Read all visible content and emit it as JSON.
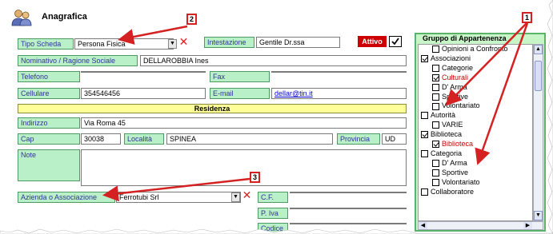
{
  "header": {
    "title": "Anagrafica",
    "icon": "users-icon"
  },
  "form": {
    "tipo_scheda": {
      "label": "Tipo Scheda",
      "value": "Persona Fisica"
    },
    "intestazione": {
      "label": "Intestazione",
      "value": "Gentile Dr.ssa"
    },
    "attivo": {
      "label": "Attivo",
      "checked": true
    },
    "nominativo": {
      "label": "Nominativo / Ragione Sociale",
      "value": "DELLAROBBIA  Ines"
    },
    "telefono": {
      "label": "Telefono",
      "value": ""
    },
    "fax": {
      "label": "Fax",
      "value": ""
    },
    "cellulare": {
      "label": "Cellulare",
      "value": "354546456"
    },
    "email": {
      "label": "E-mail",
      "value": "dellar@tin.it"
    },
    "section_residenza": "Residenza",
    "indirizzo": {
      "label": "Indirizzo",
      "value": "Via Roma 45"
    },
    "cap": {
      "label": "Cap",
      "value": "30038"
    },
    "localita": {
      "label": "Località",
      "value": "SPINEA"
    },
    "provincia": {
      "label": "Provincia",
      "value": "UD"
    },
    "note": {
      "label": "Note",
      "value": ""
    },
    "azienda": {
      "label": "Azienda o Associazione",
      "value": "Ferrotubi Srl"
    },
    "cf": {
      "label": "C.F.",
      "value": ""
    },
    "piva": {
      "label": "P. Iva",
      "value": ""
    },
    "codice": {
      "label": "Codice",
      "value": ""
    }
  },
  "gruppo": {
    "title": "Gruppo di Appartenenza",
    "items": [
      {
        "label": "Opinioni a Confronto",
        "level": 1,
        "checked": false,
        "color": "#000000"
      },
      {
        "label": "Associazioni",
        "level": 0,
        "checked": true,
        "color": "#000000"
      },
      {
        "label": "Categorie",
        "level": 1,
        "checked": false,
        "color": "#000000"
      },
      {
        "label": "Culturali",
        "level": 1,
        "checked": true,
        "color": "#cc0000"
      },
      {
        "label": "D' Arma",
        "level": 1,
        "checked": false,
        "color": "#000000"
      },
      {
        "label": "Sportive",
        "level": 1,
        "checked": false,
        "color": "#000000"
      },
      {
        "label": "Volontariato",
        "level": 1,
        "checked": false,
        "color": "#000000"
      },
      {
        "label": "Autorità",
        "level": 0,
        "checked": false,
        "color": "#000000"
      },
      {
        "label": "VARIE",
        "level": 1,
        "checked": false,
        "color": "#000000"
      },
      {
        "label": "Biblioteca",
        "level": 0,
        "checked": true,
        "color": "#000000"
      },
      {
        "label": "Biblioteca",
        "level": 1,
        "checked": true,
        "color": "#cc0000"
      },
      {
        "label": "Categoria",
        "level": 0,
        "checked": false,
        "color": "#000000"
      },
      {
        "label": "D' Arma",
        "level": 1,
        "checked": false,
        "color": "#000000"
      },
      {
        "label": "Sportive",
        "level": 1,
        "checked": false,
        "color": "#000000"
      },
      {
        "label": "Volontariato",
        "level": 1,
        "checked": false,
        "color": "#000000"
      },
      {
        "label": "Collaboratore",
        "level": 0,
        "checked": false,
        "color": "#000000"
      }
    ]
  },
  "callouts": [
    "1",
    "2",
    "3"
  ],
  "colors": {
    "label_bg": "#b9f0c8",
    "label_text": "#333399",
    "section_bg": "#ffff99",
    "attivo_bg": "#cc0000",
    "arrow": "#d42222",
    "panel_border": "#5bb36a"
  }
}
